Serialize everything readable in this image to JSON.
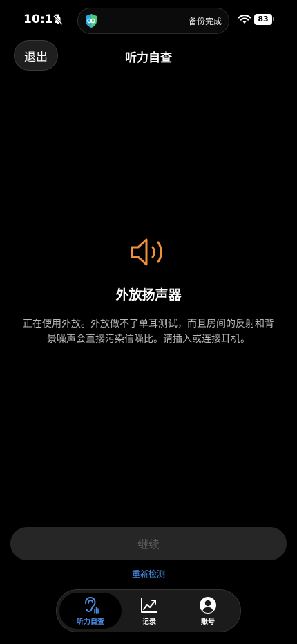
{
  "status_bar": {
    "time": "10:11",
    "island_text": "备份完成",
    "battery": "83"
  },
  "header": {
    "exit_label": "退出",
    "title": "听力自查"
  },
  "main": {
    "icon": "speaker-icon",
    "headline": "外放扬声器",
    "description": "正在使用外放。外放做不了单耳测试，而且房间的反射和背景噪声会直接污染信噪比。请插入或连接耳机。"
  },
  "actions": {
    "continue_label": "继续",
    "recheck_label": "重新检测"
  },
  "tabs": [
    {
      "label": "听力自查",
      "icon": "ear-icon",
      "active": true
    },
    {
      "label": "记录",
      "icon": "trend-chart-icon",
      "active": false
    },
    {
      "label": "账号",
      "icon": "account-icon",
      "active": false
    }
  ],
  "colors": {
    "accent_orange": "#f0913a",
    "link_blue": "#4a90e8",
    "active_tab_blue": "#4a8fe6",
    "background": "#000000"
  }
}
